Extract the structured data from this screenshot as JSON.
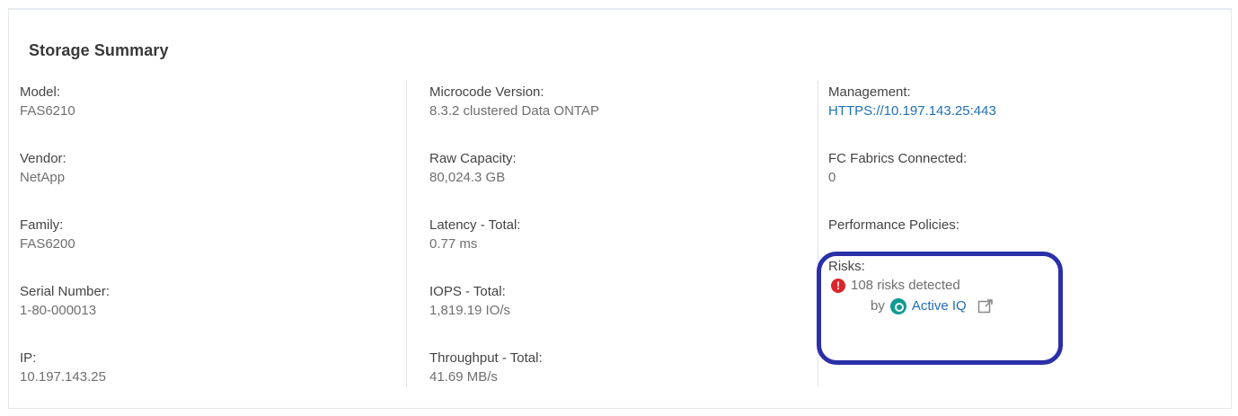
{
  "card": {
    "title": "Storage Summary"
  },
  "columns": [
    [
      {
        "label": "Model:",
        "value": "FAS6210"
      },
      {
        "label": "Vendor:",
        "value": "NetApp"
      },
      {
        "label": "Family:",
        "value": "FAS6200"
      },
      {
        "label": "Serial Number:",
        "value": "1-80-000013"
      },
      {
        "label": "IP:",
        "value": "10.197.143.25"
      }
    ],
    [
      {
        "label": "Microcode Version:",
        "value": "8.3.2 clustered Data ONTAP"
      },
      {
        "label": "Raw Capacity:",
        "value": "80,024.3 GB"
      },
      {
        "label": "Latency - Total:",
        "value": "0.77 ms"
      },
      {
        "label": "IOPS - Total:",
        "value": "1,819.19 IO/s"
      },
      {
        "label": "Throughput - Total:",
        "value": "41.69 MB/s"
      }
    ],
    [
      {
        "label": "Management:",
        "value": "HTTPS://10.197.143.25:443"
      },
      {
        "label": "FC Fabrics Connected:",
        "value": "0"
      },
      {
        "label": "Performance Policies:",
        "value": ""
      },
      {
        "label": "Risks:"
      }
    ]
  ],
  "risks": {
    "text": "108 risks detected",
    "by": "by",
    "source": "Active IQ",
    "icons": [
      "alert-icon",
      "active-iq-logo-icon",
      "external-link-icon"
    ]
  },
  "colors": {
    "link": "#1f6fb5",
    "alert": "#d9262b",
    "active_iq": "#0f9a95",
    "highlight": "#2b2fa8"
  }
}
